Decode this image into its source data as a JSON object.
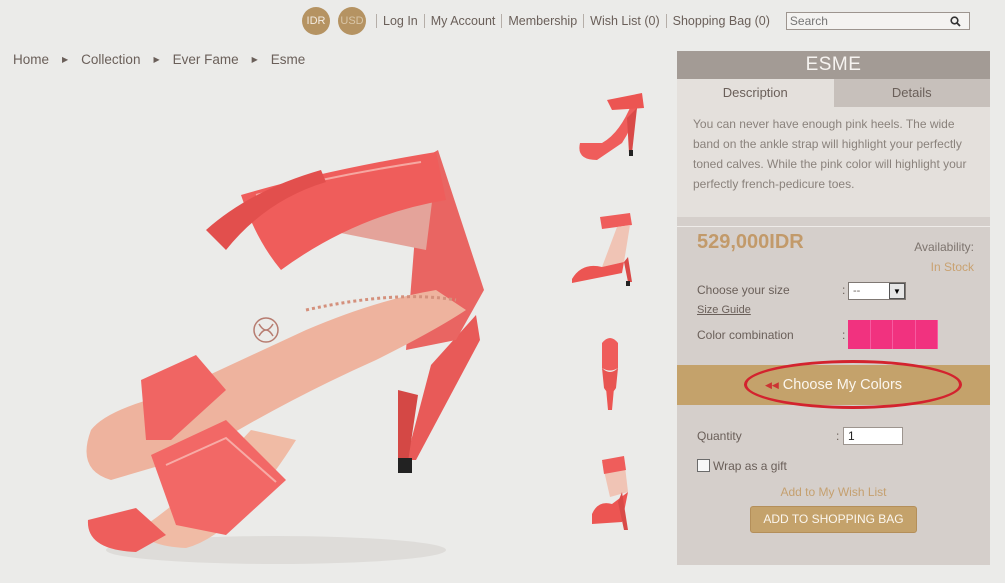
{
  "currency": {
    "idr": "IDR",
    "usd": "USD"
  },
  "nav": {
    "login": "Log In",
    "account": "My Account",
    "membership": "Membership",
    "wishlist": "Wish List (0)",
    "bag": "Shopping Bag (0)"
  },
  "search": {
    "placeholder": "Search"
  },
  "breadcrumb": [
    "Home",
    "Collection",
    "Ever Fame",
    "Esme"
  ],
  "product": {
    "name": "ESME",
    "tabs": [
      "Description",
      "Details"
    ],
    "description": "You can never have enough pink heels. The wide band on the ankle strap will highlight your perfectly toned calves. While the pink color will highlight your perfectly french-pedicure toes.",
    "price": "529,000IDR",
    "availability_label": "Availability:",
    "availability_value": "In Stock",
    "size_label": "Choose your size",
    "size_value": "--",
    "size_guide": "Size Guide",
    "color_label": "Color combination",
    "color_hex": "#f1327f",
    "choose_colors": "Choose My Colors",
    "quantity_label": "Quantity",
    "quantity_value": "1",
    "gift_label": "Wrap as a gift",
    "wishlist_link": "Add to My Wish List",
    "add_button": "ADD TO SHOPPING BAG"
  },
  "colors": {
    "accent": "#c4a26b",
    "shoe": "#f0605e",
    "highlight_ring": "#d3232e"
  }
}
